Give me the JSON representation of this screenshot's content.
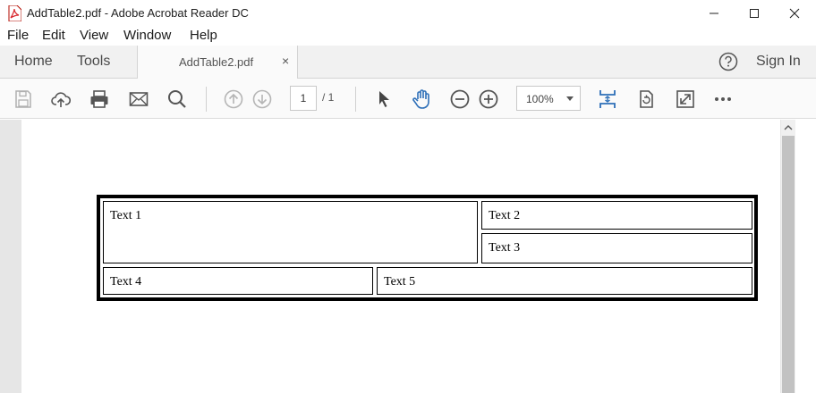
{
  "window": {
    "title": "AddTable2.pdf - Adobe Acrobat Reader DC",
    "minimize_icon": "minimize-icon",
    "maximize_icon": "maximize-icon",
    "close_icon": "close-icon"
  },
  "menu": {
    "items": [
      "File",
      "Edit",
      "View",
      "Window",
      "Help"
    ]
  },
  "nav": {
    "home": "Home",
    "tools": "Tools",
    "tab_label": "AddTable2.pdf",
    "tab_close": "×",
    "sign_in": "Sign In",
    "help_icon": "help-icon"
  },
  "toolbar": {
    "page_current": "1",
    "page_total": "/ 1",
    "zoom": "100%",
    "icons": [
      "save-icon",
      "cloud-upload-icon",
      "print-icon",
      "email-icon",
      "search-icon",
      "page-up-icon",
      "page-down-icon",
      "select-cursor-icon",
      "hand-tool-icon",
      "zoom-out-icon",
      "zoom-in-icon",
      "scroll-mode-icon",
      "rotate-icon",
      "full-screen-icon",
      "more-icon"
    ],
    "accent_color": "#2d6fb8"
  },
  "document": {
    "cells": [
      "Text 1",
      "Text 2",
      "Text 3",
      "Text 4",
      "Text 5"
    ]
  }
}
